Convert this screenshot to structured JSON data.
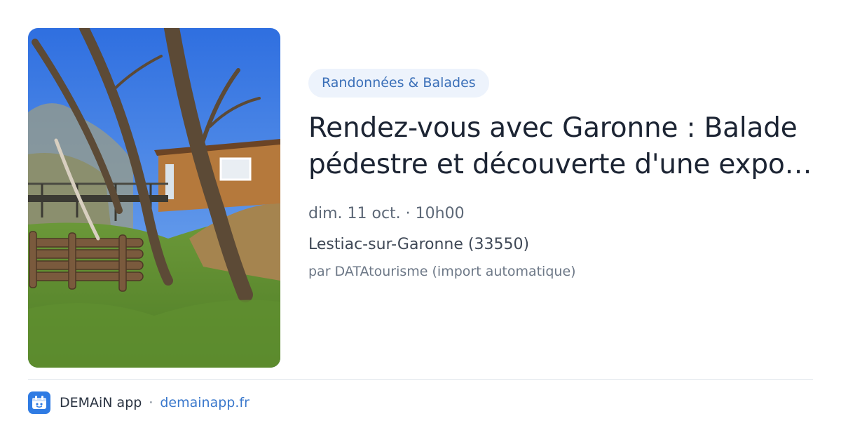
{
  "event": {
    "category": "Randonnées & Balades",
    "title": "Rendez-vous avec Garonne : Balade pédestre et découverte d'une expo…",
    "datetime": "dim. 11 oct. · 10h00",
    "location": "Lestiac-sur-Garonne (33550)",
    "source": "par DATAtourisme (import automatique)",
    "image_icon": "event-photo-icon"
  },
  "footer": {
    "app_name": "DEMAiN app",
    "separator": "·",
    "domain": "demainapp.fr",
    "logo_icon": "demain-app-logo-icon"
  },
  "colors": {
    "chip_bg": "#edf3fc",
    "chip_text": "#3a6fb8",
    "link": "#3a78cc",
    "logo_bg": "#2f7be3"
  }
}
